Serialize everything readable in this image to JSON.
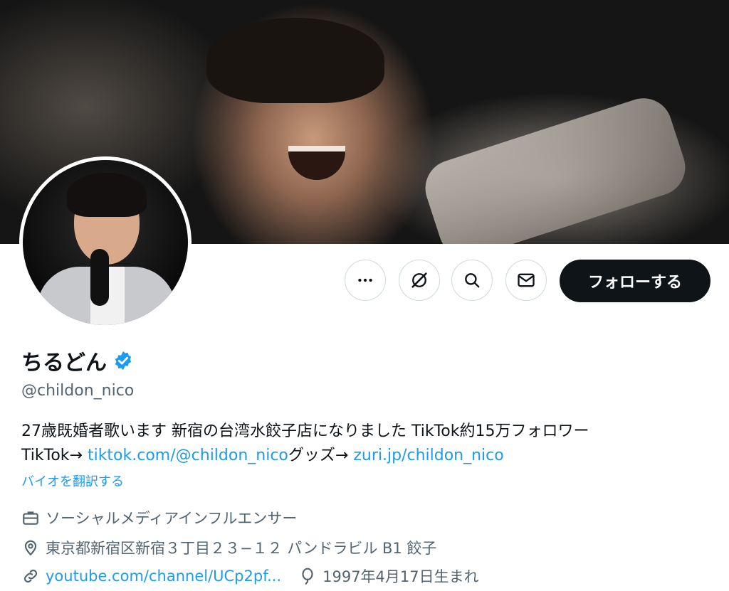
{
  "banner": {
    "image_name": "profile-banner-photo"
  },
  "avatar": {
    "image_name": "profile-avatar-photo"
  },
  "actions": {
    "more_icon": "more-icon",
    "grok_icon": "grok-icon",
    "search_icon": "search-icon",
    "message_icon": "mail-icon",
    "follow_label": "フォローする"
  },
  "profile": {
    "name": "ちるどん",
    "verified_icon": "verified-badge-icon",
    "handle": "@childon_nico",
    "bio_line1": "27歳既婚者歌います 新宿の台湾水餃子店になりました TikTok約15万フォロワー",
    "bio_line2_prefix": "TikTok→ ",
    "bio_link1": "tiktok.com/@childon_nico",
    "bio_line2_middle": "グッズ→ ",
    "bio_link2": "zuri.jp/childon_nico",
    "translate_label": "バイオを翻訳する",
    "category": "ソーシャルメディアインフルエンサー",
    "location": "東京都新宿区新宿３丁目２３−１２ パンドラビル B1 餃子",
    "website": "youtube.com/channel/UCp2pf...",
    "birthday": "1997年4月17日生まれ"
  },
  "colors": {
    "link": "#1d9bf0",
    "secondary_text": "#536471",
    "primary_text": "#0f1419",
    "follow_bg": "#0f1419",
    "verified": "#1d9bf0"
  }
}
